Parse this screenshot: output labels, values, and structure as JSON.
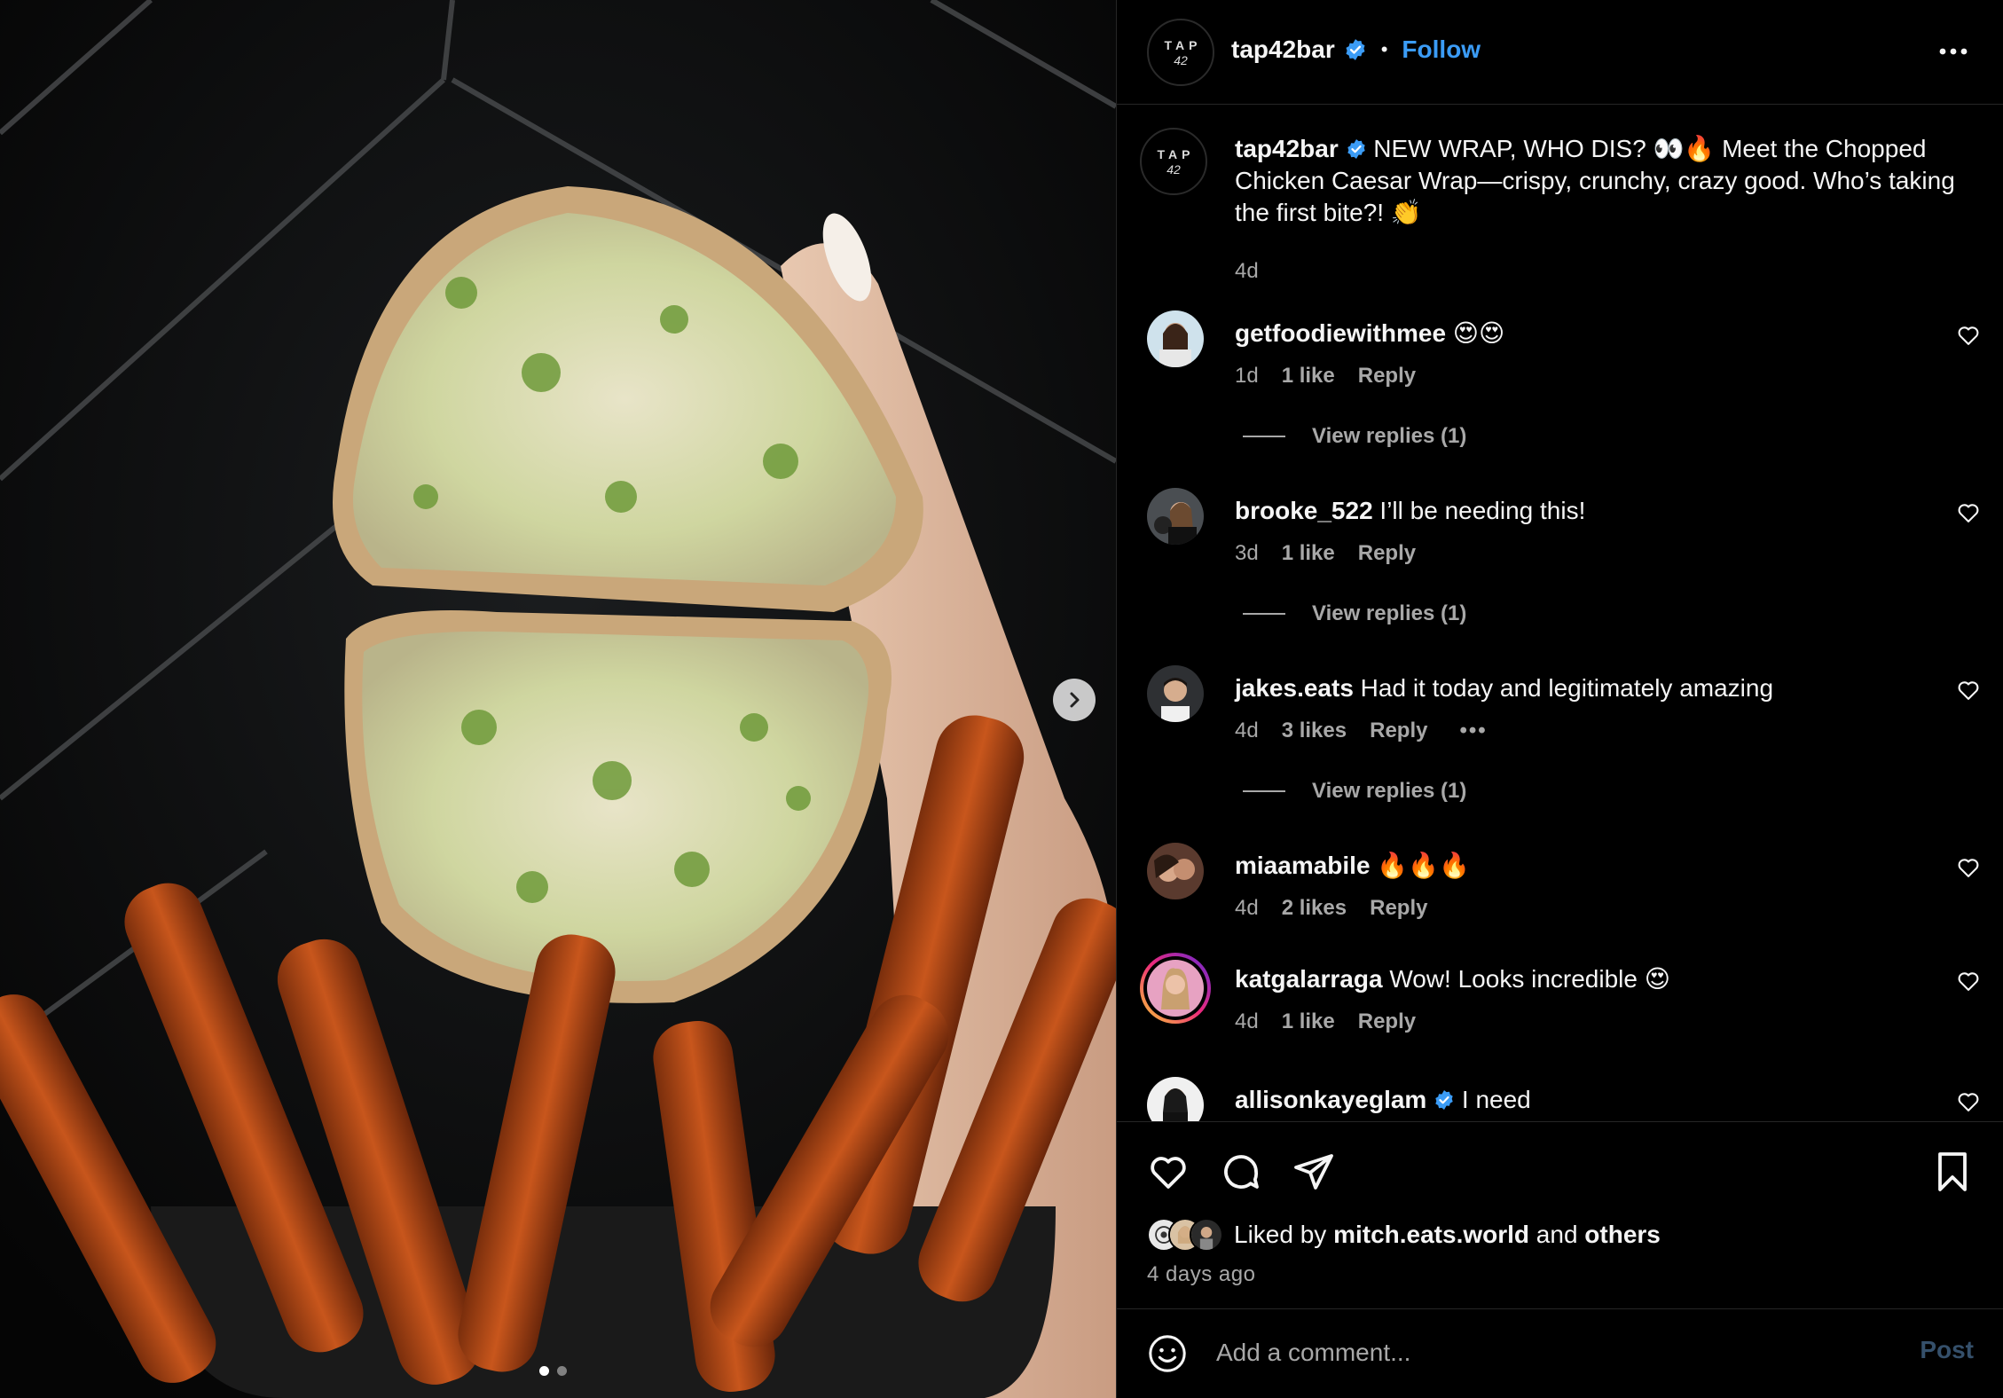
{
  "post": {
    "author": "tap42bar",
    "follow_label": "Follow",
    "separator": "•",
    "logo_top": "TAP",
    "logo_bottom": "42"
  },
  "caption": {
    "username": "tap42bar",
    "text": "NEW WRAP, WHO DIS? 👀🔥 Meet the Chopped Chicken Caesar Wrap—crispy, crunchy, crazy good. Who’s taking the first bite?! 👏",
    "time": "4d"
  },
  "comments": [
    {
      "username": "getfoodiewithmee",
      "text": "😍😍",
      "time": "1d",
      "likes": "1 like",
      "reply": "Reply",
      "view_replies": "View replies (1)"
    },
    {
      "username": "brooke_522",
      "text": "I’ll be needing this!",
      "time": "3d",
      "likes": "1 like",
      "reply": "Reply",
      "view_replies": "View replies (1)"
    },
    {
      "username": "jakes.eats",
      "text": "Had it today and legitimately amazing",
      "time": "4d",
      "likes": "3 likes",
      "reply": "Reply",
      "more": "•••",
      "view_replies": "View replies (1)"
    },
    {
      "username": "miaamabile",
      "text": "🔥🔥🔥",
      "time": "4d",
      "likes": "2 likes",
      "reply": "Reply"
    },
    {
      "username": "katgalarraga",
      "text": "Wow! Looks incredible 😍",
      "time": "4d",
      "likes": "1 like",
      "reply": "Reply"
    },
    {
      "username": "allisonkayeglam",
      "text": "I need"
    }
  ],
  "likes": {
    "prefix": "Liked by",
    "user": "mitch.eats.world",
    "middle": "and",
    "others": "others"
  },
  "time_ago": "4 days ago",
  "add_comment": {
    "placeholder": "Add a comment...",
    "post_label": "Post"
  },
  "carousel": {
    "current": 1,
    "total": 2
  },
  "colors": {
    "accent": "#3b9cf6",
    "verified": "#3b9cf6",
    "text_secondary": "#a8a8a8",
    "background": "#000000"
  }
}
